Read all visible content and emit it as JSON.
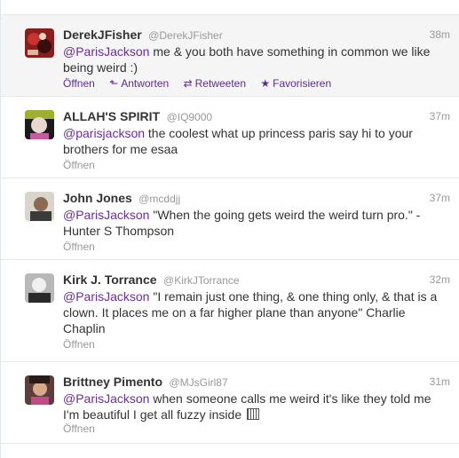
{
  "tweets": [
    {
      "fullname": "DerekJFisher",
      "username": "@DerekJFisher",
      "time": "38m",
      "mention": "@ParisJackson",
      "text": " me & you both have something in common we like being weird :)",
      "actions": {
        "open": "Öffnen",
        "reply": "Antworten",
        "retweet": "Retweeten",
        "favorite": "Favorisieren"
      }
    },
    {
      "fullname": "ALLAH'S SPIRIT",
      "username": "@IQ9000",
      "time": "37m",
      "mention": "@parisjackson",
      "text": " the coolest what up princess paris say hi to your brothers for me esaa",
      "open": "Öffnen"
    },
    {
      "fullname": "John Jones",
      "username": "@mcddjj",
      "time": "37m",
      "mention": "@ParisJackson",
      "text": " \"When the going gets weird the weird turn pro.\" - Hunter S Thompson",
      "open": "Öffnen"
    },
    {
      "fullname": "Kirk J. Torrance",
      "username": "@KirkJTorrance",
      "time": "32m",
      "mention": "@ParisJackson",
      "text": " \"I remain just one thing, & one thing only, & that is a clown. It places me on a far higher plane than anyone\" Charlie Chaplin",
      "open": "Öffnen"
    },
    {
      "fullname": "Brittney Pimento",
      "username": "@MJsGirl87",
      "time": "31m",
      "mention": "@ParisJackson",
      "text": " when someone calls me weird it's like they told me I'm beautiful I get all fuzzy inside ",
      "open": "Öffnen"
    }
  ],
  "colors": {
    "link": "#6b2d95",
    "muted": "#999999",
    "border": "#e8e8e8"
  },
  "icons": {
    "reply": "reply-arrow-icon",
    "retweet": "retweet-icon",
    "favorite": "star-icon"
  }
}
